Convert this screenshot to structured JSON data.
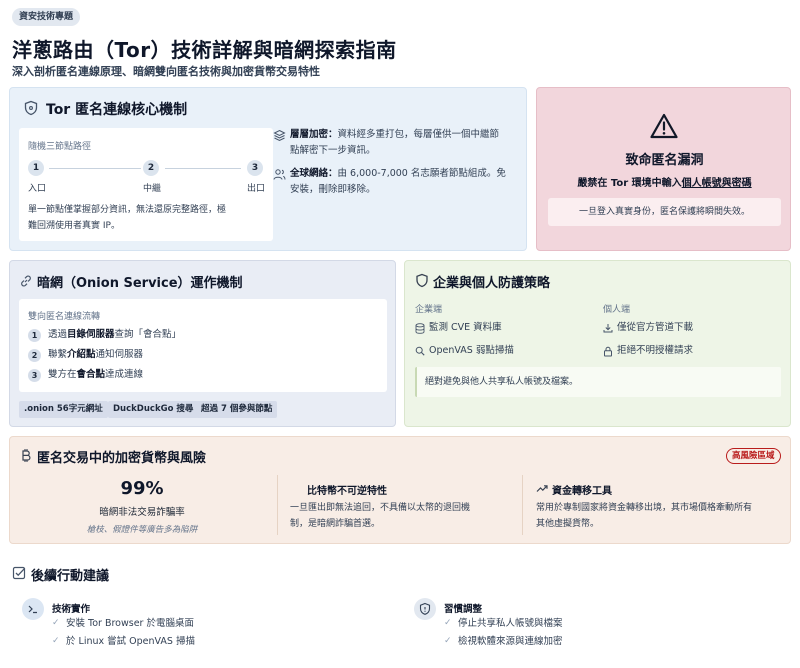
{
  "header": {
    "badge": "資安技術專題",
    "title": "洋蔥路由（Tor）技術詳解與暗網探索指南",
    "subtitle": "深入剖析匿名連線原理、暗網雙向匿名技術與加密貨幣交易特性"
  },
  "tor_core": {
    "title": "Tor 匿名連線核心機制",
    "path_label": "隨機三節點路徑",
    "nodes": [
      {
        "num": "1",
        "label": "入口"
      },
      {
        "num": "2",
        "label": "中繼"
      },
      {
        "num": "3",
        "label": "出口"
      }
    ],
    "path_note_1": "單一節點僅掌握部分資訊，無法還原完整路徑，極",
    "path_note_2": "難回溯使用者真實 IP。",
    "features": [
      {
        "title": "層層加密：",
        "text_1": "資料經多重打包，每層僅供一個中繼節",
        "text_2": "點解密下一步資訊。"
      },
      {
        "title": "全球網絡：",
        "text_1": "由 6,000-7,000 名志願者節點組成。免",
        "text_2": "安裝，刪除即移除。"
      }
    ]
  },
  "warning": {
    "title": "致命匿名漏洞",
    "line_prefix": "嚴禁在 Tor 環境中輸入",
    "line_emphasis": "個人帳號與密碼",
    "note": "一旦登入真實身份，匿名保護將瞬間失效。"
  },
  "onion": {
    "title": "暗網（Onion Service）運作機制",
    "flow_label": "雙向匿名連線流轉",
    "steps": [
      {
        "num": "1",
        "pre": "透過",
        "bold": "目錄伺服器",
        "post": "查詢「會合點」"
      },
      {
        "num": "2",
        "pre": "聯繫",
        "bold": "介紹點",
        "post": "通知伺服器"
      },
      {
        "num": "3",
        "pre": "雙方在",
        "bold": "會合點",
        "post": "達成連線"
      }
    ],
    "tags": [
      ".onion 56字元網址",
      "DuckDuckGo 搜尋",
      "超過 7 個參與節點"
    ]
  },
  "defense": {
    "title": "企業與個人防護策略",
    "enterprise_label": "企業端",
    "enterprise_items": [
      "監測 CVE 資料庫",
      "OpenVAS 弱點掃描"
    ],
    "personal_label": "個人端",
    "personal_items": [
      "僅從官方管道下載",
      "拒絕不明授權請求"
    ],
    "note": "絕對避免與他人共享私人帳號及檔案。"
  },
  "crypto": {
    "title": "匿名交易中的加密貨幣與風險",
    "badge": "高風險區域",
    "stat_value": "99%",
    "stat_label": "暗網非法交易詐騙率",
    "stat_note": "槍枝、假證件等廣告多為陷阱",
    "col2_title": "比特幣不可逆特性",
    "col2_text_1": "一旦匯出即無法追回，不具備以太幣的退回機",
    "col2_text_2": "制，是暗網詐騙首選。",
    "col3_title": "資金轉移工具",
    "col3_text_1": "常用於專制國家將資金轉移出境，其市場價格牽動所有",
    "col3_text_2": "其他虛擬貨幣。"
  },
  "actions": {
    "title": "後續行動建議",
    "groups": [
      {
        "title": "技術實作",
        "items": [
          "安裝 Tor Browser 於電腦桌面",
          "於 Linux 嘗試 OpenVAS 掃描"
        ]
      },
      {
        "title": "習慣調整",
        "items": [
          "停止共享私人帳號與檔案",
          "檢視軟體來源與連線加密"
        ]
      }
    ]
  },
  "colors": {
    "core_bg": "#e9f1f9",
    "warning_bg": "#f2d6dc",
    "onion_bg": "#e9edf5",
    "defense_bg": "#eef5e7",
    "crypto_bg": "#f8ede6",
    "risk_badge": "#b91c1c"
  }
}
